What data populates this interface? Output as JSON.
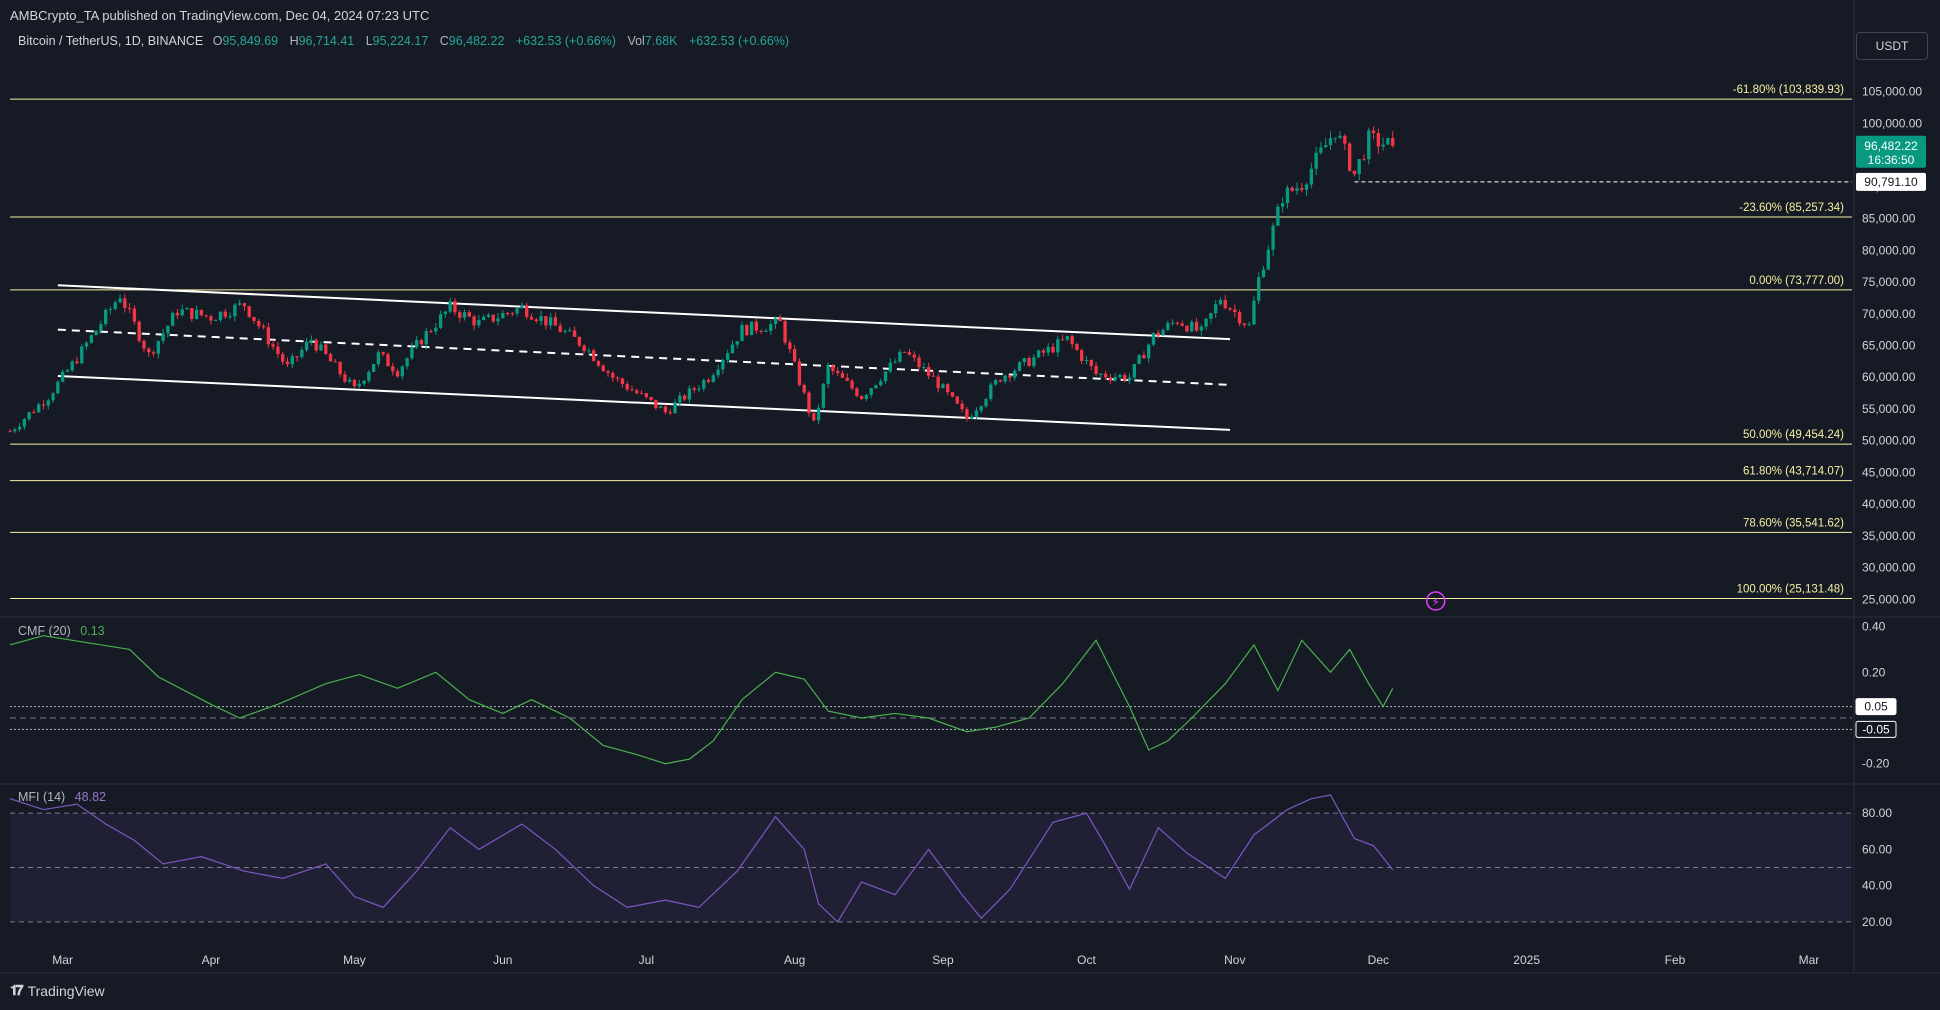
{
  "header": {
    "publisher_line": "AMBCrypto_TA published on TradingView.com, Dec 04, 2024 07:23 UTC"
  },
  "legend": {
    "symbol": "Bitcoin / TetherUS, 1D, BINANCE",
    "open_label": "O",
    "open": "95,849.69",
    "high_label": "H",
    "high": "96,714.41",
    "low_label": "L",
    "low": "95,224.17",
    "close_label": "C",
    "close": "96,482.22",
    "change": "+632.53 (+0.66%)",
    "vol_label": "Vol",
    "vol": "7.68K",
    "vol_change": "+632.53 (+0.66%)"
  },
  "currency_button": "USDT",
  "price_tag": {
    "value": "96,482.22",
    "countdown": "16:36:50",
    "color": "#089981"
  },
  "low_tag": "90,791.10",
  "indicators": {
    "cmf": {
      "name": "CMF (20)",
      "value": "0.13",
      "color": "#4caf50"
    },
    "mfi": {
      "name": "MFI (14)",
      "value": "48.82",
      "color": "#7e57c2"
    }
  },
  "brand": "TradingView",
  "colors": {
    "up": "#089981",
    "down": "#f23645",
    "fib": "#f5f0a0",
    "bg": "#161a25",
    "channel": "#ffffff"
  },
  "chart_data": [
    {
      "type": "candlestick",
      "title": "Bitcoin / TetherUS, 1D, BINANCE",
      "y_axis_ticks": [
        "105,000.00",
        "100,000.00",
        "95,000.00",
        "90,000.00",
        "85,000.00",
        "80,000.00",
        "75,000.00",
        "70,000.00",
        "65,000.00",
        "60,000.00",
        "55,000.00",
        "50,000.00",
        "45,000.00",
        "40,000.00",
        "35,000.00",
        "30,000.00",
        "25,000.00"
      ],
      "x_axis_ticks": [
        "Mar",
        "Apr",
        "May",
        "Jun",
        "Jul",
        "Aug",
        "Sep",
        "Oct",
        "Nov",
        "Dec",
        "2025",
        "Feb",
        "Mar"
      ],
      "ylim": [
        23000,
        110000
      ],
      "fib_levels": [
        {
          "label": "-61.80% (103,839.93)",
          "price": 103839.93
        },
        {
          "label": "-23.60% (85,257.34)",
          "price": 85257.34
        },
        {
          "label": "0.00% (73,777.00)",
          "price": 73777.0
        },
        {
          "label": "50.00% (49,454.24)",
          "price": 49454.24
        },
        {
          "label": "61.80% (43,714.07)",
          "price": 43714.07
        },
        {
          "label": "78.60% (35,541.62)",
          "price": 35541.62
        },
        {
          "label": "100.00% (25,131.48)",
          "price": 25131.48
        }
      ],
      "channel": {
        "upper": [
          {
            "date": "2024-02-29",
            "price": 74500
          },
          {
            "date": "2024-10-31",
            "price": 66000
          }
        ],
        "mid": [
          {
            "date": "2024-02-29",
            "price": 67500
          },
          {
            "date": "2024-10-31",
            "price": 58800
          }
        ],
        "lower": [
          {
            "date": "2024-02-29",
            "price": 60200
          },
          {
            "date": "2024-10-31",
            "price": 51700
          }
        ]
      },
      "horizontal_line": {
        "price": 90791.1,
        "style": "dashed"
      },
      "last_price": 96482.22,
      "price_path": [
        [
          "2024-02-19",
          51500
        ],
        [
          "2024-02-27",
          57000
        ],
        [
          "2024-03-04",
          63000
        ],
        [
          "2024-03-13",
          73000
        ],
        [
          "2024-03-19",
          63500
        ],
        [
          "2024-03-25",
          70500
        ],
        [
          "2024-04-01",
          69500
        ],
        [
          "2024-04-08",
          71500
        ],
        [
          "2024-04-17",
          61500
        ],
        [
          "2024-04-22",
          66000
        ],
        [
          "2024-05-01",
          58000
        ],
        [
          "2024-05-06",
          63500
        ],
        [
          "2024-05-10",
          61000
        ],
        [
          "2024-05-15",
          66000
        ],
        [
          "2024-05-21",
          71000
        ],
        [
          "2024-05-27",
          68500
        ],
        [
          "2024-06-05",
          71000
        ],
        [
          "2024-06-12",
          68000
        ],
        [
          "2024-06-18",
          65000
        ],
        [
          "2024-06-24",
          60000
        ],
        [
          "2024-07-05",
          54500
        ],
        [
          "2024-07-14",
          60000
        ],
        [
          "2024-07-21",
          67500
        ],
        [
          "2024-07-29",
          68500
        ],
        [
          "2024-08-05",
          52500
        ],
        [
          "2024-08-08",
          61500
        ],
        [
          "2024-08-15",
          57000
        ],
        [
          "2024-08-24",
          64000
        ],
        [
          "2024-08-31",
          59000
        ],
        [
          "2024-09-06",
          53500
        ],
        [
          "2024-09-13",
          60000
        ],
        [
          "2024-09-20",
          63000
        ],
        [
          "2024-09-27",
          66000
        ],
        [
          "2024-10-03",
          60500
        ],
        [
          "2024-10-10",
          60000
        ],
        [
          "2024-10-15",
          66500
        ],
        [
          "2024-10-20",
          69000
        ],
        [
          "2024-10-25",
          67000
        ],
        [
          "2024-10-29",
          72500
        ],
        [
          "2024-11-04",
          68000
        ],
        [
          "2024-11-06",
          75500
        ],
        [
          "2024-11-11",
          88500
        ],
        [
          "2024-11-15",
          90500
        ],
        [
          "2024-11-22",
          99000
        ],
        [
          "2024-11-26",
          92000
        ],
        [
          "2024-11-29",
          97500
        ],
        [
          "2024-12-04",
          96482
        ]
      ],
      "date_range": [
        "2024-02-19",
        "2025-03-10"
      ]
    },
    {
      "type": "line",
      "title": "CMF (20)",
      "current_value": 0.13,
      "levels": [
        0.05,
        -0.05
      ],
      "y_axis_ticks": [
        "0.40",
        "0.20",
        "0.05",
        "-0.05",
        "-0.20"
      ],
      "ylim": [
        -0.28,
        0.42
      ],
      "points": [
        [
          "2024-02-19",
          0.32
        ],
        [
          "2024-02-26",
          0.36
        ],
        [
          "2024-03-06",
          0.33
        ],
        [
          "2024-03-15",
          0.3
        ],
        [
          "2024-03-21",
          0.18
        ],
        [
          "2024-04-01",
          0.06
        ],
        [
          "2024-04-07",
          0.0
        ],
        [
          "2024-04-15",
          0.06
        ],
        [
          "2024-04-25",
          0.15
        ],
        [
          "2024-05-02",
          0.19
        ],
        [
          "2024-05-10",
          0.13
        ],
        [
          "2024-05-18",
          0.2
        ],
        [
          "2024-05-25",
          0.08
        ],
        [
          "2024-06-01",
          0.02
        ],
        [
          "2024-06-07",
          0.08
        ],
        [
          "2024-06-15",
          0.0
        ],
        [
          "2024-06-22",
          -0.12
        ],
        [
          "2024-06-29",
          -0.16
        ],
        [
          "2024-07-05",
          -0.2
        ],
        [
          "2024-07-10",
          -0.18
        ],
        [
          "2024-07-15",
          -0.1
        ],
        [
          "2024-07-21",
          0.08
        ],
        [
          "2024-07-28",
          0.2
        ],
        [
          "2024-08-03",
          0.17
        ],
        [
          "2024-08-08",
          0.03
        ],
        [
          "2024-08-15",
          0.0
        ],
        [
          "2024-08-22",
          0.02
        ],
        [
          "2024-08-29",
          0.0
        ],
        [
          "2024-09-06",
          -0.06
        ],
        [
          "2024-09-12",
          -0.04
        ],
        [
          "2024-09-19",
          0.0
        ],
        [
          "2024-09-26",
          0.15
        ],
        [
          "2024-10-03",
          0.34
        ],
        [
          "2024-10-10",
          0.05
        ],
        [
          "2024-10-14",
          -0.14
        ],
        [
          "2024-10-18",
          -0.1
        ],
        [
          "2024-10-23",
          0.0
        ],
        [
          "2024-10-30",
          0.15
        ],
        [
          "2024-11-05",
          0.32
        ],
        [
          "2024-11-10",
          0.12
        ],
        [
          "2024-11-15",
          0.34
        ],
        [
          "2024-11-21",
          0.2
        ],
        [
          "2024-11-25",
          0.3
        ],
        [
          "2024-11-29",
          0.15
        ],
        [
          "2024-12-02",
          0.05
        ],
        [
          "2024-12-04",
          0.13
        ]
      ]
    },
    {
      "type": "line",
      "title": "MFI (14)",
      "current_value": 48.82,
      "levels": [
        80,
        50,
        20
      ],
      "y_axis_ticks": [
        "80.00",
        "60.00",
        "40.00",
        "20.00"
      ],
      "ylim": [
        10,
        95
      ],
      "points": [
        [
          "2024-02-19",
          88
        ],
        [
          "2024-02-26",
          82
        ],
        [
          "2024-03-04",
          85
        ],
        [
          "2024-03-10",
          74
        ],
        [
          "2024-03-16",
          65
        ],
        [
          "2024-03-22",
          52
        ],
        [
          "2024-03-30",
          56
        ],
        [
          "2024-04-08",
          48
        ],
        [
          "2024-04-16",
          44
        ],
        [
          "2024-04-25",
          52
        ],
        [
          "2024-05-01",
          34
        ],
        [
          "2024-05-07",
          28
        ],
        [
          "2024-05-14",
          48
        ],
        [
          "2024-05-21",
          72
        ],
        [
          "2024-05-27",
          60
        ],
        [
          "2024-06-05",
          74
        ],
        [
          "2024-06-12",
          60
        ],
        [
          "2024-06-20",
          40
        ],
        [
          "2024-06-27",
          28
        ],
        [
          "2024-07-05",
          32
        ],
        [
          "2024-07-12",
          28
        ],
        [
          "2024-07-20",
          48
        ],
        [
          "2024-07-28",
          78
        ],
        [
          "2024-08-03",
          60
        ],
        [
          "2024-08-06",
          30
        ],
        [
          "2024-08-10",
          20
        ],
        [
          "2024-08-15",
          42
        ],
        [
          "2024-08-22",
          35
        ],
        [
          "2024-08-29",
          60
        ],
        [
          "2024-09-05",
          35
        ],
        [
          "2024-09-09",
          22
        ],
        [
          "2024-09-15",
          38
        ],
        [
          "2024-09-24",
          75
        ],
        [
          "2024-10-01",
          80
        ],
        [
          "2024-10-05",
          62
        ],
        [
          "2024-10-10",
          38
        ],
        [
          "2024-10-16",
          72
        ],
        [
          "2024-10-22",
          58
        ],
        [
          "2024-10-30",
          44
        ],
        [
          "2024-11-05",
          68
        ],
        [
          "2024-11-12",
          82
        ],
        [
          "2024-11-17",
          88
        ],
        [
          "2024-11-21",
          90
        ],
        [
          "2024-11-26",
          66
        ],
        [
          "2024-11-30",
          62
        ],
        [
          "2024-12-04",
          48.82
        ]
      ]
    }
  ]
}
